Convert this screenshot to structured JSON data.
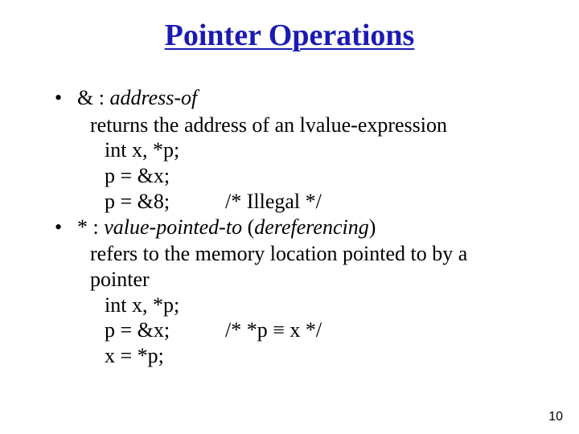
{
  "title": "Pointer Operations",
  "bullets": [
    {
      "symbol": "&",
      "sep": " : ",
      "name": "address-of",
      "desc": "returns the address of an lvalue-expression",
      "code": [
        {
          "c1": "int  x,  *p;",
          "c2": ""
        },
        {
          "c1": "p = &x;",
          "c2": ""
        },
        {
          "c1": "p = &8;",
          "c2": "/* Illegal */"
        }
      ]
    },
    {
      "symbol": "*",
      "sep": "  : ",
      "name": "value-pointed-to",
      "paren_open": " (",
      "paren_term": "dereferencing",
      "paren_close": ")",
      "desc": "refers to the memory location pointed to by a pointer",
      "code": [
        {
          "c1": "int  x,  *p;",
          "c2": ""
        },
        {
          "c1": "p = &x;",
          "c2": "/* *p ≡ x */"
        },
        {
          "c1": "x = *p;",
          "c2": ""
        }
      ]
    }
  ],
  "page_number": "10"
}
